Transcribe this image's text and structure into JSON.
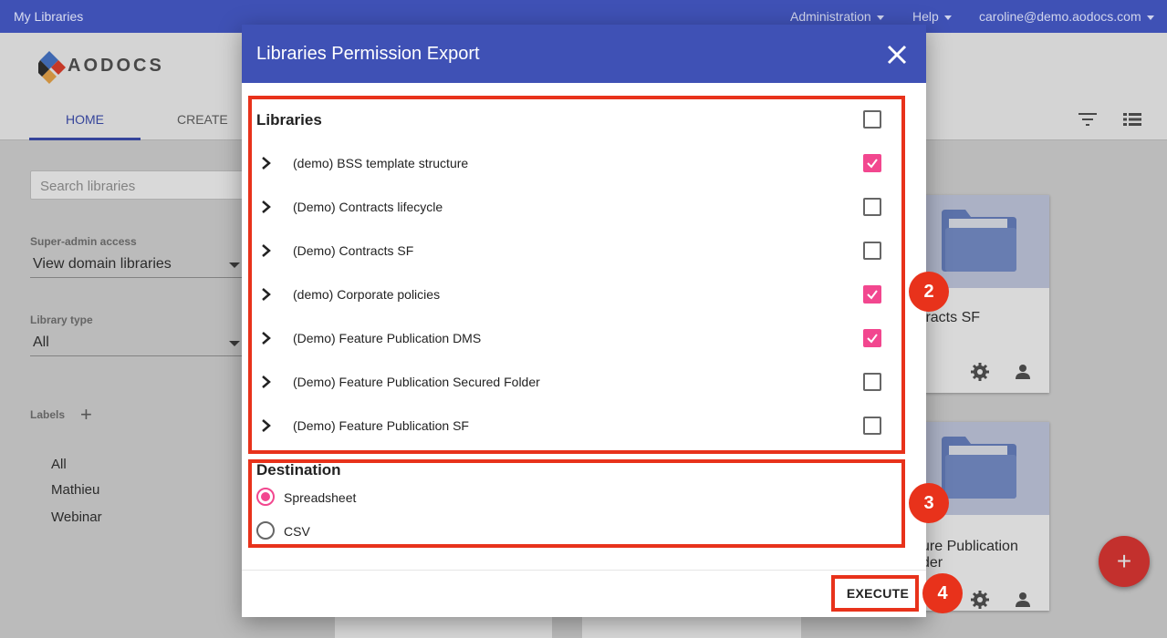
{
  "topbar": {
    "app_title": "My Libraries",
    "menu_admin": "Administration",
    "menu_help": "Help",
    "user_email": "caroline@demo.aodocs.com"
  },
  "background": {
    "logo_text": "AODOCS",
    "tabs": [
      "HOME",
      "CREATE"
    ],
    "search_placeholder": "Search libraries",
    "super_admin_label": "Super-admin access",
    "super_admin_value": "View domain libraries",
    "library_type_label": "Library type",
    "library_type_value": "All",
    "labels_title": "Labels",
    "labels": [
      "All",
      "Mathieu",
      "Webinar"
    ],
    "card1_title": "tracts SF",
    "card2_title_line1": "ure Publication",
    "card2_title_line2": "der",
    "fab_label": "+"
  },
  "dialog": {
    "title": "Libraries Permission Export",
    "libraries_title": "Libraries",
    "select_all_checked": false,
    "libraries": [
      {
        "name": "(demo) BSS template structure",
        "checked": true
      },
      {
        "name": "(Demo) Contracts lifecycle",
        "checked": false
      },
      {
        "name": "(Demo) Contracts SF",
        "checked": false
      },
      {
        "name": "(demo) Corporate policies",
        "checked": true
      },
      {
        "name": "(Demo) Feature Publication DMS",
        "checked": true
      },
      {
        "name": "(Demo) Feature Publication Secured Folder",
        "checked": false
      },
      {
        "name": "(Demo) Feature Publication SF",
        "checked": false
      }
    ],
    "destination_title": "Destination",
    "destinations": [
      {
        "label": "Spreadsheet",
        "selected": true
      },
      {
        "label": "CSV",
        "selected": false
      }
    ],
    "execute_label": "EXECUTE"
  },
  "annotations": {
    "steps": [
      "2",
      "3",
      "4"
    ],
    "highlight_color": "#e8321b"
  },
  "colors": {
    "primary": "#3f51b5",
    "accent": "#f2478f",
    "fab": "#e53935"
  }
}
